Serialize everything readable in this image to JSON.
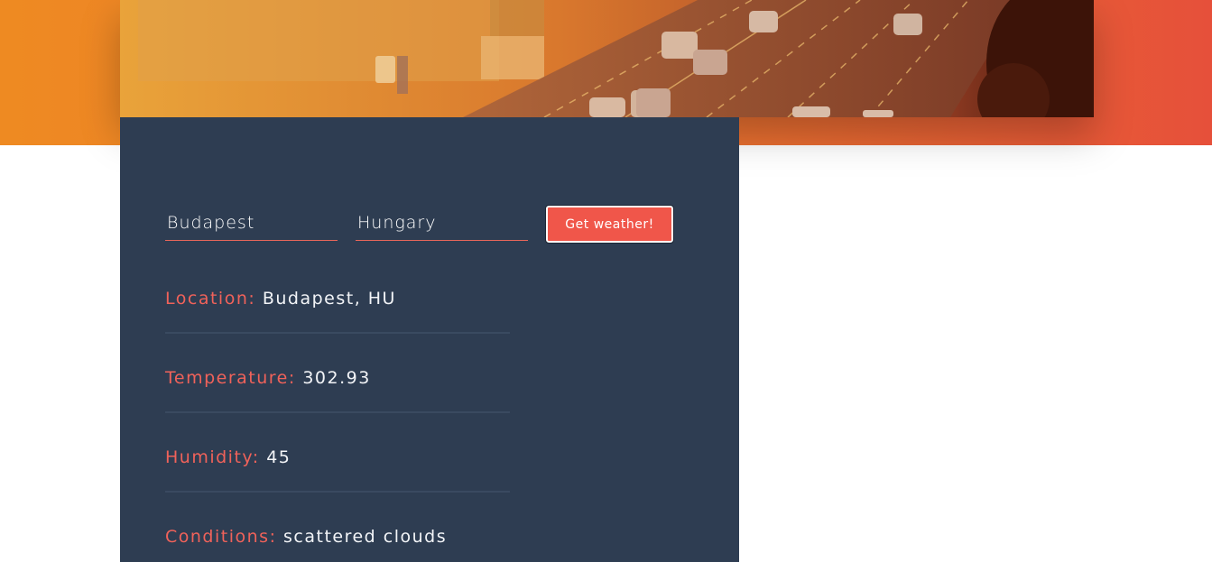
{
  "form": {
    "city_value": "Budapest",
    "country_value": "Hungary",
    "submit_label": "Get weather!"
  },
  "weather": {
    "location_label": "Location:",
    "location_value": "Budapest, HU",
    "temperature_label": "Temperature:",
    "temperature_value": "302.93",
    "humidity_label": "Humidity:",
    "humidity_value": "45",
    "conditions_label": "Conditions:",
    "conditions_value": "scattered clouds"
  },
  "colors": {
    "accent": "#f0564a",
    "panel": "#2e3d52",
    "band_start": "#ee8a22",
    "band_end": "#e6503a"
  }
}
